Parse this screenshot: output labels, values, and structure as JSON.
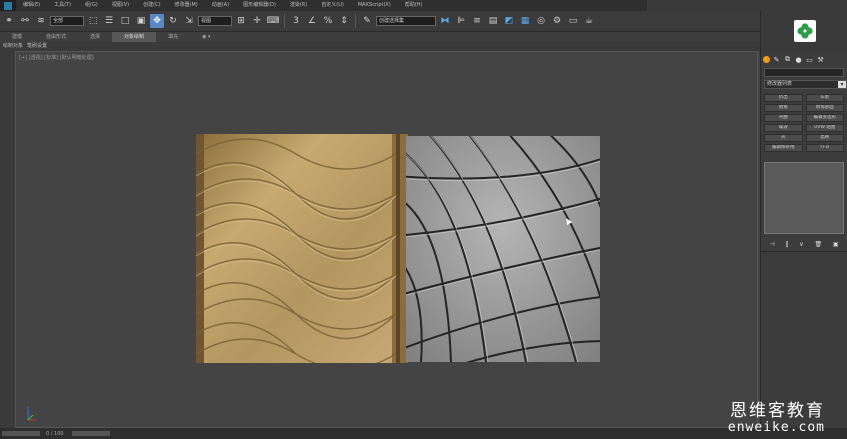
{
  "menubar": {
    "items": [
      "编辑(E)",
      "工具(T)",
      "组(G)",
      "视图(V)",
      "创建(C)",
      "修改器(M)",
      "动画(A)",
      "图形编辑器(D)",
      "渲染(R)",
      "自定义(U)",
      "MAXScript(X)",
      "帮助(H)"
    ]
  },
  "toolbar": {
    "filter_select": "全部",
    "view_select": "视图",
    "named_selection": "创建选择集"
  },
  "ribbon": {
    "tabs": [
      "建模",
      "自由形式",
      "选择",
      "对象绘制",
      "填充"
    ],
    "active_tab": "对象绘制",
    "sub_items": [
      "绘制对象",
      "笔刷设置"
    ]
  },
  "viewport": {
    "label": "[+] [透视] [标准] [默认明暗处理]"
  },
  "command_panel": {
    "modifier_list": "修改器列表",
    "modifiers": [
      "挤出",
      "车削",
      "倒角",
      "倒角剖面",
      "弯曲",
      "编辑多边形",
      "噪波",
      "UVW 贴图",
      "壳",
      "晶格",
      "编辑样条线",
      "FFD"
    ]
  },
  "statusbar": {
    "frame_range": "0 / 100"
  },
  "watermark": {
    "chinese": "恩维客教育",
    "url": "enweike.com"
  },
  "colors": {
    "viewport_bg": "#444444",
    "texture_tan": "#b89a62",
    "geometry_gray": "#9a9a9a",
    "active_blue": "#5a87c5",
    "create_tab_orange": "#f39c12",
    "logo_green": "#2e9c4a"
  }
}
